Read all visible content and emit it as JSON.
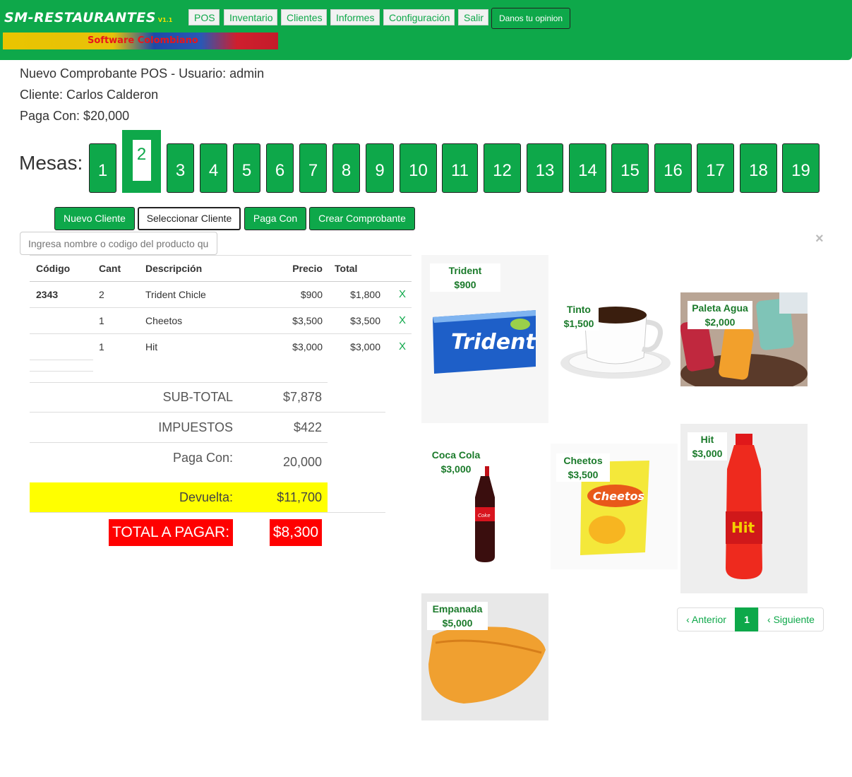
{
  "brand": {
    "name": "SM-RESTAURANTES",
    "version": "V1.1",
    "banner_text": "Software Colombiano"
  },
  "nav": {
    "pos": "POS",
    "inventario": "Inventario",
    "clientes": "Clientes",
    "informes": "Informes",
    "configuracion": "Configuración",
    "salir": "Salir",
    "opinion": "Danos tu opinion"
  },
  "info": {
    "title": "Nuevo Comprobante POS - Usuario: admin",
    "cliente": "Cliente: Carlos Calderon",
    "paga_con": "Paga Con: $20,000"
  },
  "mesas": {
    "label": "Mesas:",
    "active": "2",
    "items": [
      "1",
      "2",
      "3",
      "4",
      "5",
      "6",
      "7",
      "8",
      "9",
      "10",
      "11",
      "12",
      "13",
      "14",
      "15",
      "16",
      "17",
      "18",
      "19"
    ]
  },
  "actions": {
    "nuevo_cliente": "Nuevo Cliente",
    "seleccionar_cliente": "Seleccionar Cliente",
    "paga_con": "Paga Con",
    "crear_comprobante": "Crear Comprobante"
  },
  "search": {
    "placeholder": "Ingresa nombre o codigo del producto qu"
  },
  "table": {
    "headers": {
      "codigo": "Código",
      "cant": "Cant",
      "descripcion": "Descripción",
      "precio": "Precio",
      "total": "Total"
    },
    "rows": [
      {
        "codigo": "2343",
        "cant": "2",
        "descripcion": "Trident Chicle",
        "precio": "$900",
        "total": "$1,800",
        "remove": "X"
      },
      {
        "codigo": "",
        "cant": "1",
        "descripcion": "Cheetos",
        "precio": "$3,500",
        "total": "$3,500",
        "remove": "X"
      },
      {
        "codigo": "",
        "cant": "1",
        "descripcion": "Hit",
        "precio": "$3,000",
        "total": "$3,000",
        "remove": "X"
      }
    ]
  },
  "summary": {
    "subtotal_label": "SUB-TOTAL",
    "subtotal": "$7,878",
    "impuestos_label": "IMPUESTOS",
    "impuestos": "$422",
    "paga_con_label": "Paga Con:",
    "paga_con": "20,000",
    "devuelta_label": "Devuelta:",
    "devuelta": "$11,700",
    "total_label": "TOTAL A PAGAR:",
    "total": "$8,300"
  },
  "products": [
    {
      "name": "Trident Chicle",
      "price": "$900",
      "icon": "chewing-gum-image"
    },
    {
      "name": "Tinto",
      "price": "$1,500",
      "icon": "coffee-cup-image"
    },
    {
      "name": "Paleta Agua",
      "price": "$2,000",
      "icon": "popsicle-image"
    },
    {
      "name": "Coca Cola",
      "price": "$3,000",
      "icon": "cola-bottle-image"
    },
    {
      "name": "Cheetos",
      "price": "$3,500",
      "icon": "snack-bag-image"
    },
    {
      "name": "Hit",
      "price": "$3,000",
      "icon": "juice-bottle-image"
    },
    {
      "name": "Empanada",
      "price": "$5,000",
      "icon": "empanada-image"
    }
  ],
  "close": "×",
  "pagination": {
    "prev": "‹ Anterior",
    "current": "1",
    "next": "‹ Siguiente"
  },
  "colors": {
    "brand_green": "#0ea84a",
    "total_red": "#ff0000",
    "devuelta_yellow": "#ffff00"
  }
}
